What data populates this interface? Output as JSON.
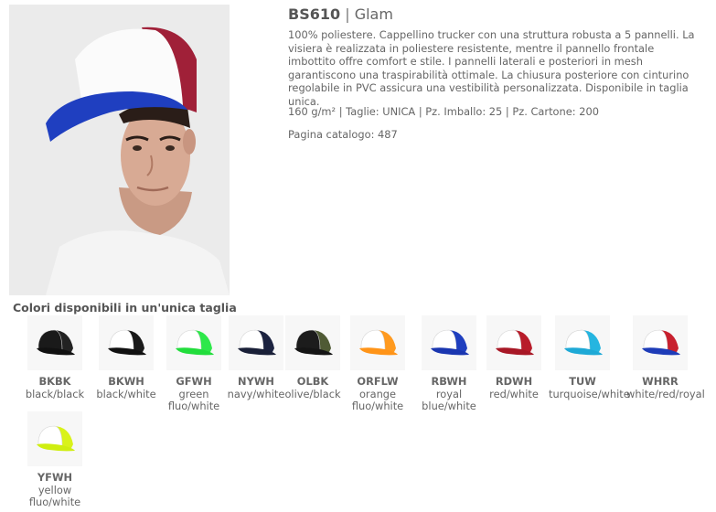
{
  "product": {
    "code": "BS610",
    "separator": "|",
    "name": "Glam",
    "description": "100% poliestere. Cappellino trucker con una struttura robusta a 5 pannelli. La visiera è realizzata in poliestere resistente, mentre il pannello frontale imbottito offre comfort e stile. I pannelli laterali e posteriori in mesh garantiscono una traspirabilità ottimale. La chiusura posteriore con cinturino regolabile in PVC assicura una vestibilità personalizzata. Disponibile in taglia unica.",
    "specs": "160 g/m² | Taglie: UNICA | Pz. Imballo: 25 | Pz. Cartone: 200",
    "catalog_page": "Pagina catalogo: 487"
  },
  "colors_section": {
    "title": "Colori disponibili in un'unica taglia",
    "items": [
      {
        "code": "BKBK",
        "name": "black/black",
        "front": "#1a1a1a",
        "back": "#222222",
        "visor": "#111111"
      },
      {
        "code": "BKWH",
        "name": "black/white",
        "front": "#ffffff",
        "back": "#1a1a1a",
        "visor": "#111111"
      },
      {
        "code": "GFWH",
        "name": "green fluo/white",
        "front": "#ffffff",
        "back": "#2ee84a",
        "visor": "#22dd3c"
      },
      {
        "code": "NYWH",
        "name": "navy/white",
        "front": "#ffffff",
        "back": "#1c2340",
        "visor": "#1a2038"
      },
      {
        "code": "OLBK",
        "name": "olive/black",
        "front": "#1c1c1c",
        "back": "#4f5a34",
        "visor": "#151515"
      },
      {
        "code": "ORFLW",
        "name": "orange fluo/white",
        "front": "#ffffff",
        "back": "#ff9a1f",
        "visor": "#ff9418"
      },
      {
        "code": "RBWH",
        "name": "royal blue/white",
        "front": "#ffffff",
        "back": "#1f3fbf",
        "visor": "#1a36b0"
      },
      {
        "code": "RDWH",
        "name": "red/white",
        "front": "#ffffff",
        "back": "#b81c2a",
        "visor": "#a81826"
      },
      {
        "code": "TUW",
        "name": "turquoise/white",
        "front": "#ffffff",
        "back": "#25b5e0",
        "visor": "#1ea9d6"
      },
      {
        "code": "WHRR",
        "name": "white/red/royal",
        "front": "#ffffff",
        "back": "#c8202e",
        "visor": "#1e3cb8"
      },
      {
        "code": "YFWH",
        "name": "yellow fluo/white",
        "front": "#ffffff",
        "back": "#d9f21a",
        "visor": "#cfee10"
      }
    ]
  }
}
